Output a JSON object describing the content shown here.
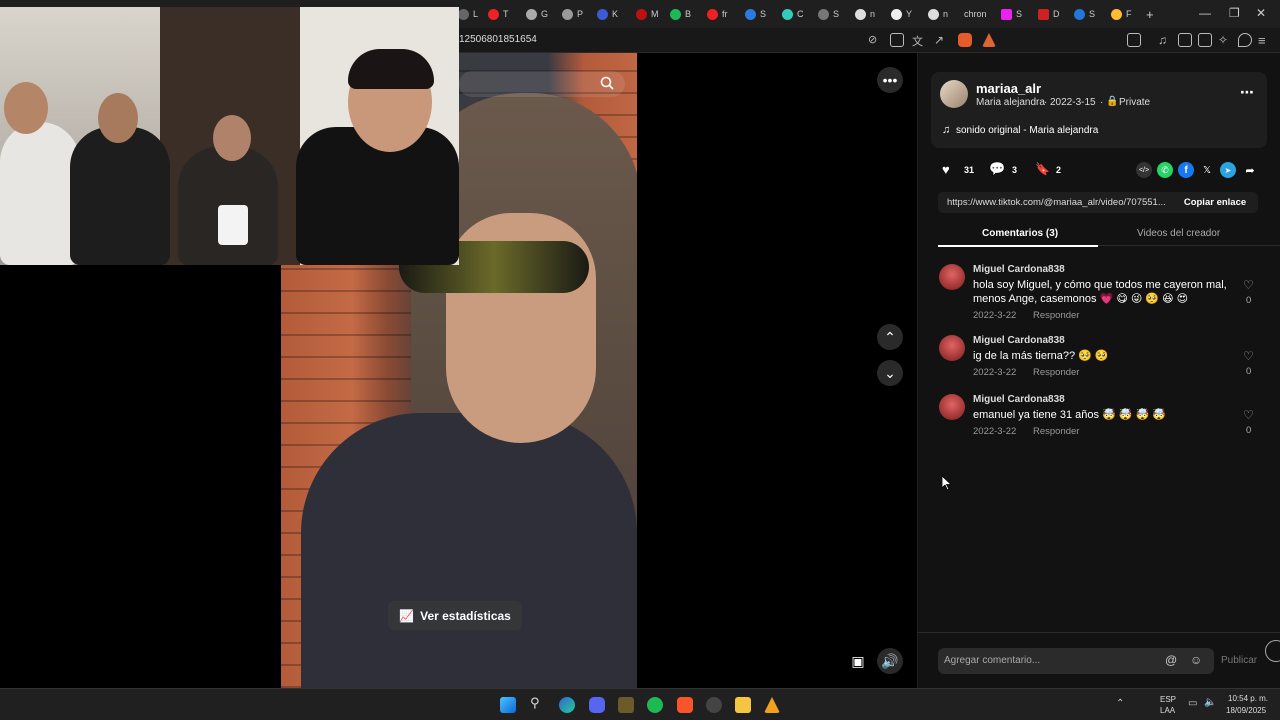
{
  "browser": {
    "url": "12506801851654",
    "tabs": [
      "L",
      "T",
      "G",
      "P",
      "K",
      "M",
      "B",
      "fr",
      "S",
      "C",
      "S",
      "n",
      "Y",
      "n",
      "chron",
      "S",
      "D",
      "S",
      "F"
    ],
    "new_tab": "+"
  },
  "video": {
    "stats_label": "Ver estadísticas"
  },
  "post": {
    "username": "mariaa_alr",
    "display_name": "Maria alejandra",
    "date": "2022-3-15",
    "privacy": "Private",
    "sound": "sonido original - Maria alejandra",
    "likes": "31",
    "comments": "3",
    "saves": "2",
    "link": "https://www.tiktok.com/@mariaa_alr/video/707551...",
    "copy_link": "Copiar enlace"
  },
  "tabs": {
    "comments": "Comentarios (3)",
    "creator_videos": "Videos del creador"
  },
  "comments": [
    {
      "user": "Miguel Cardona838",
      "text": "hola soy Miguel, y cómo que todos me cayeron mal, menos Ange, casemonos 💗 😋 😜 🥺 😆 😍",
      "date": "2022-3-22",
      "reply": "Responder",
      "likes": "0"
    },
    {
      "user": "Miguel Cardona838",
      "text": "ig de la más tierna?? 🥺 🥺",
      "date": "2022-3-22",
      "reply": "Responder",
      "likes": "0"
    },
    {
      "user": "Miguel Cardona838",
      "text": "emanuel ya tiene 31 años 🤯 🤯 🤯 🤯",
      "date": "2022-3-22",
      "reply": "Responder",
      "likes": "0"
    }
  ],
  "composer": {
    "placeholder": "Agregar comentario...",
    "publish": "Publicar"
  },
  "tray": {
    "lang": "ESP",
    "lang2": "LAA",
    "time": "10:54 p. m.",
    "date": "18/09/2025"
  }
}
